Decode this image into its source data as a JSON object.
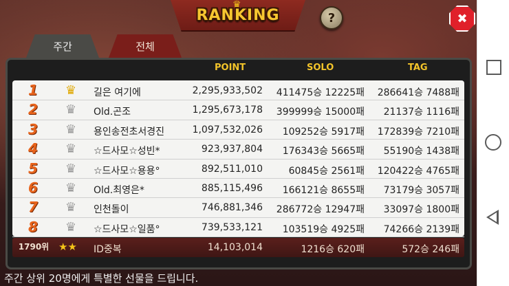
{
  "header": {
    "title": "RANKING",
    "help_label": "?",
    "close_label": "✖"
  },
  "tabs": [
    {
      "label": "주간"
    },
    {
      "label": "전체"
    }
  ],
  "columns": {
    "point": "POINT",
    "solo": "SOLO",
    "tag": "TAG"
  },
  "rows": [
    {
      "rank": "1",
      "crown": "gold",
      "name": "길은 여기에",
      "point": "2,295,933,502",
      "solo": "411475승 12225패",
      "tag": "286641승 7488패"
    },
    {
      "rank": "2",
      "crown": "silver",
      "name": "Old.곤조",
      "point": "1,295,673,178",
      "solo": "399999승 15000패",
      "tag": "21137승 1116패"
    },
    {
      "rank": "3",
      "crown": "silver",
      "name": "용인송전초서경진",
      "point": "1,097,532,026",
      "solo": "109252승 5917패",
      "tag": "172839승 7210패"
    },
    {
      "rank": "4",
      "crown": "silver",
      "name": "☆드사모☆성빈*",
      "point": "923,937,804",
      "solo": "176343승 5665패",
      "tag": "55190승 1438패"
    },
    {
      "rank": "5",
      "crown": "silver",
      "name": "☆드사모☆용용°",
      "point": "892,511,010",
      "solo": "60845승 2561패",
      "tag": "120422승 4765패"
    },
    {
      "rank": "6",
      "crown": "silver",
      "name": "Old.최영은*",
      "point": "885,115,496",
      "solo": "166121승 8655패",
      "tag": "73179승 3057패"
    },
    {
      "rank": "7",
      "crown": "silver",
      "name": "인천돌이",
      "point": "746,881,346",
      "solo": "286772승 12947패",
      "tag": "33097승 1800패"
    },
    {
      "rank": "8",
      "crown": "silver",
      "name": "☆드사모☆일품°",
      "point": "739,533,121",
      "solo": "103519승 4925패",
      "tag": "74266승 2139패"
    }
  ],
  "my_rank": {
    "rank": "1790위",
    "stars": "★★",
    "name": "ID중복",
    "point": "14,103,014",
    "solo": "1216승 620패",
    "tag": "572승 246패"
  },
  "footer": "주간 상위 20명에게 특별한 선물을 드립니다.",
  "colors": {
    "accent": "#f3c42a",
    "rank": "#e8641c",
    "close": "#e0202a",
    "tab_active": "#4a4a46",
    "tab_inactive": "#7a1e1a"
  },
  "icons": {
    "help": "question-icon",
    "close": "close-icon",
    "crown": "crown-icon",
    "nav_recent": "square-icon",
    "nav_home": "circle-icon",
    "nav_back": "triangle-back-icon"
  }
}
